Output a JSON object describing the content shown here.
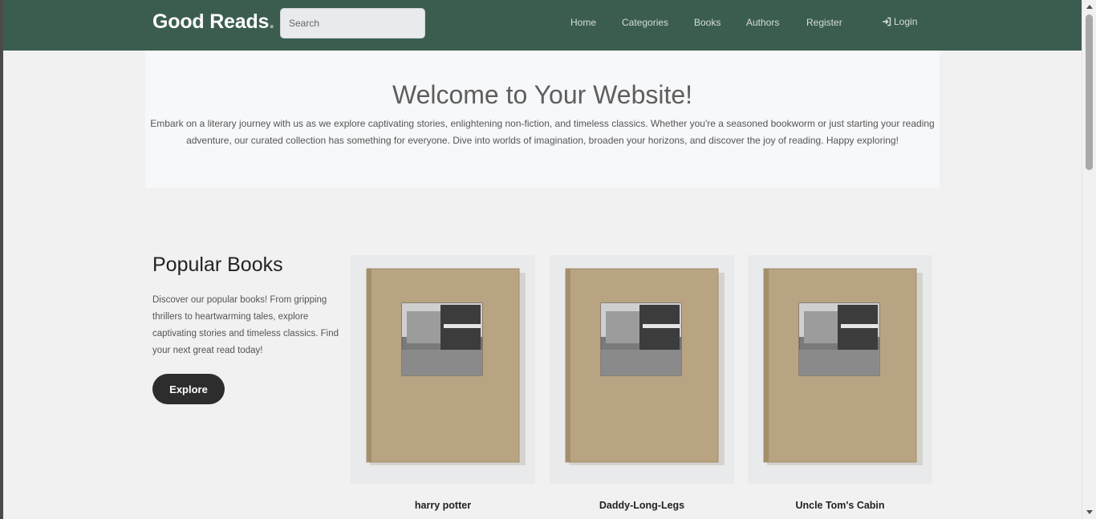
{
  "header": {
    "brand": "Good Reads",
    "brand_dot": ".",
    "search_placeholder": "Search",
    "nav": [
      {
        "label": "Home"
      },
      {
        "label": "Categories"
      },
      {
        "label": "Books"
      },
      {
        "label": "Authors"
      },
      {
        "label": "Register"
      },
      {
        "label": "Login",
        "icon": "login-icon"
      }
    ]
  },
  "hero": {
    "title": "Welcome to Your Website!",
    "text": "Embark on a literary journey with us as we explore captivating stories, enlightening non-fiction, and timeless classics. Whether you're a seasoned bookworm or just starting your reading adventure, our curated collection has something for everyone. Dive into worlds of imagination, broaden your horizons, and discover the joy of reading. Happy exploring!"
  },
  "popular": {
    "title": "Popular Books",
    "description": "Discover our popular books! From gripping thrillers to heartwarming tales, explore captivating stories and timeless classics. Find your next great read today!",
    "button_label": "Explore",
    "books": [
      {
        "title": "harry potter"
      },
      {
        "title": "Daddy-Long-Legs"
      },
      {
        "title": "Uncle Tom's Cabin"
      }
    ]
  },
  "colors": {
    "navbar": "#3b5d4f",
    "page_bg": "#f0f1f0",
    "hero_bg": "#f7f8fa",
    "button_bg": "#2d2d2d"
  }
}
